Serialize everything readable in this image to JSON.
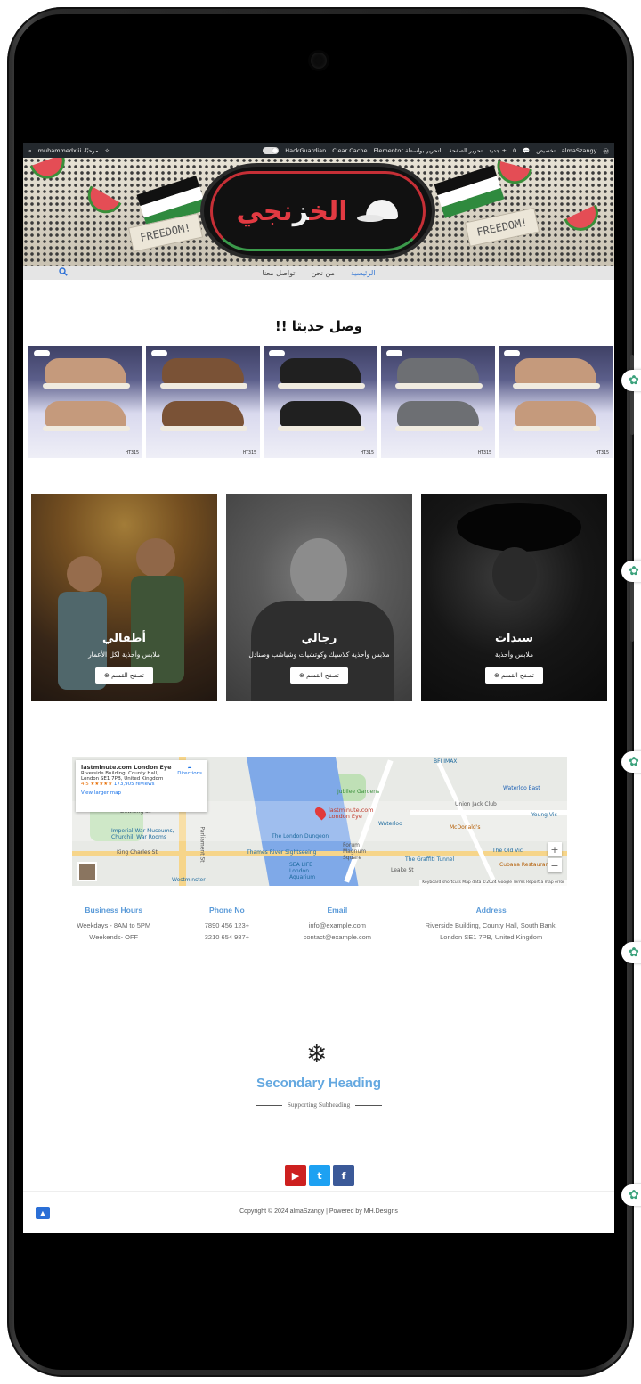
{
  "adminbar": {
    "site_name": "almaSzangy",
    "customize": "تخصيص",
    "comments_count": "0",
    "new": "جديد",
    "edit_page": "تحرير الصفحة",
    "elementor": "التحرير بواسطة Elementor",
    "clear_cache": "Clear Cache",
    "hackguardian": "HackGuardian",
    "greeting": "مرحبًا، muhammedxiii"
  },
  "nav": {
    "items": [
      "الرئيسية",
      "من نحن",
      "تواصل معنا"
    ]
  },
  "new_arrivals": {
    "title": "وصل حديثا !!",
    "products": [
      {
        "code": "HT315",
        "color": "#c59a7c"
      },
      {
        "code": "HT315",
        "color": "#7a5236"
      },
      {
        "code": "HT315",
        "color": "#202020"
      },
      {
        "code": "HT315",
        "color": "#6d6f73"
      },
      {
        "code": "HT315",
        "color": "#c59a7c"
      }
    ]
  },
  "categories": [
    {
      "title": "أطفالي",
      "desc": "ملابس وأحذية لكل الأعمار",
      "button": "تصفح القسم"
    },
    {
      "title": "رجالي",
      "desc": "ملابس وأحذية كلاسيك وكوتشيات وشباشب وصنادل",
      "button": "تصفح القسم"
    },
    {
      "title": "سيدات",
      "desc": "ملابس وأحذية",
      "button": "تصفح القسم"
    }
  ],
  "map": {
    "place": "lastminute.com London Eye",
    "address_line1": "Riverside Building, County Hall,",
    "address_line2": "London SE1 7PB, United Kingdom",
    "rating": "4.5 ★★★★★",
    "reviews": "173,905 reviews",
    "directions": "Directions",
    "larger": "View larger map",
    "pin_label": "lastminute.com London Eye",
    "labels": [
      "Waterloo East",
      "Union Jack Club",
      "Waterloo",
      "Young Vic",
      "McDonald's",
      "The London Dungeon",
      "Thames River Sightseeing",
      "Forum Magnum Square",
      "The Graffiti Tunnel",
      "The Old Vic",
      "Cubana Restaurant",
      "Imperial War Museums, Churchill War Rooms",
      "King Charles St",
      "Westminster",
      "Downing St",
      "Leake St",
      "SEA LIFE London Aquarium",
      "BFI IMAX",
      "Jubilee Gardens",
      "Parliament St"
    ],
    "footer": "Keyboard shortcuts   Map data ©2024 Google   Terms   Report a map error"
  },
  "contact": [
    {
      "heading": "Business Hours",
      "line1": "Weekdays - 8AM to 5PM",
      "line2": "Weekends- OFF"
    },
    {
      "heading": "Phone No",
      "line1": "7890 456 123+",
      "line2": "3210 654 987+"
    },
    {
      "heading": "Email",
      "line1": "info@example.com",
      "line2": "contact@example.com"
    },
    {
      "heading": "Address",
      "line1": "Riverside Building, County Hall, South Bank,",
      "line2": "London SE1 7PB, United Kingdom"
    }
  ],
  "secondary": {
    "heading": "Secondary Heading",
    "subheading": "Supporting Subheading"
  },
  "social": [
    "youtube",
    "twitter",
    "facebook"
  ],
  "colors": {
    "youtube": "#cd201f",
    "twitter": "#1da1f2",
    "facebook": "#3b5998",
    "accent": "#5a9ad8"
  },
  "footer": {
    "copyright": "Copyright © 2024 almaSzangy | Powered by MH.Designs"
  }
}
